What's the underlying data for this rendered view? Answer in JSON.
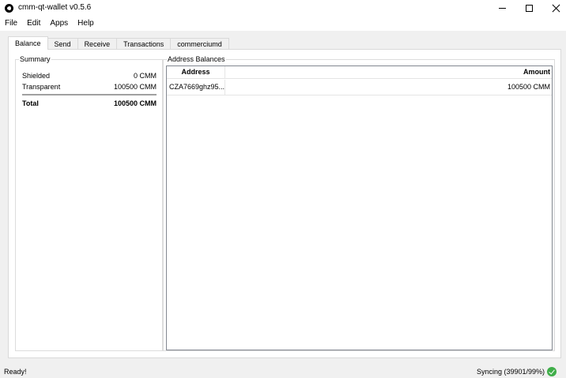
{
  "window": {
    "title": "cmm-qt-wallet v0.5.6",
    "app_icon": "app-logo-icon",
    "controls": [
      "minimize-icon",
      "maximize-icon",
      "close-icon"
    ]
  },
  "menu": {
    "items": [
      {
        "label": "File"
      },
      {
        "label": "Edit"
      },
      {
        "label": "Apps"
      },
      {
        "label": "Help"
      }
    ]
  },
  "tabs": [
    {
      "label": "Balance",
      "active": true
    },
    {
      "label": "Send"
    },
    {
      "label": "Receive"
    },
    {
      "label": "Transactions"
    },
    {
      "label": "commerciumd"
    }
  ],
  "summary": {
    "title": "Summary",
    "shielded_label": "Shielded",
    "shielded_value": "0 CMM",
    "transparent_label": "Transparent",
    "transparent_value": "100500 CMM",
    "total_label": "Total",
    "total_value": "100500 CMM"
  },
  "address_balances": {
    "title": "Address Balances",
    "columns": {
      "address": "Address",
      "amount": "Amount"
    },
    "rows": [
      {
        "address": "CZA7669ghz95...",
        "amount": "100500 CMM"
      }
    ]
  },
  "status": {
    "left": "Ready!",
    "right": "Syncing (39901/99%)",
    "sync_icon": "check-circle-icon",
    "sync_color": "#3fae49"
  }
}
